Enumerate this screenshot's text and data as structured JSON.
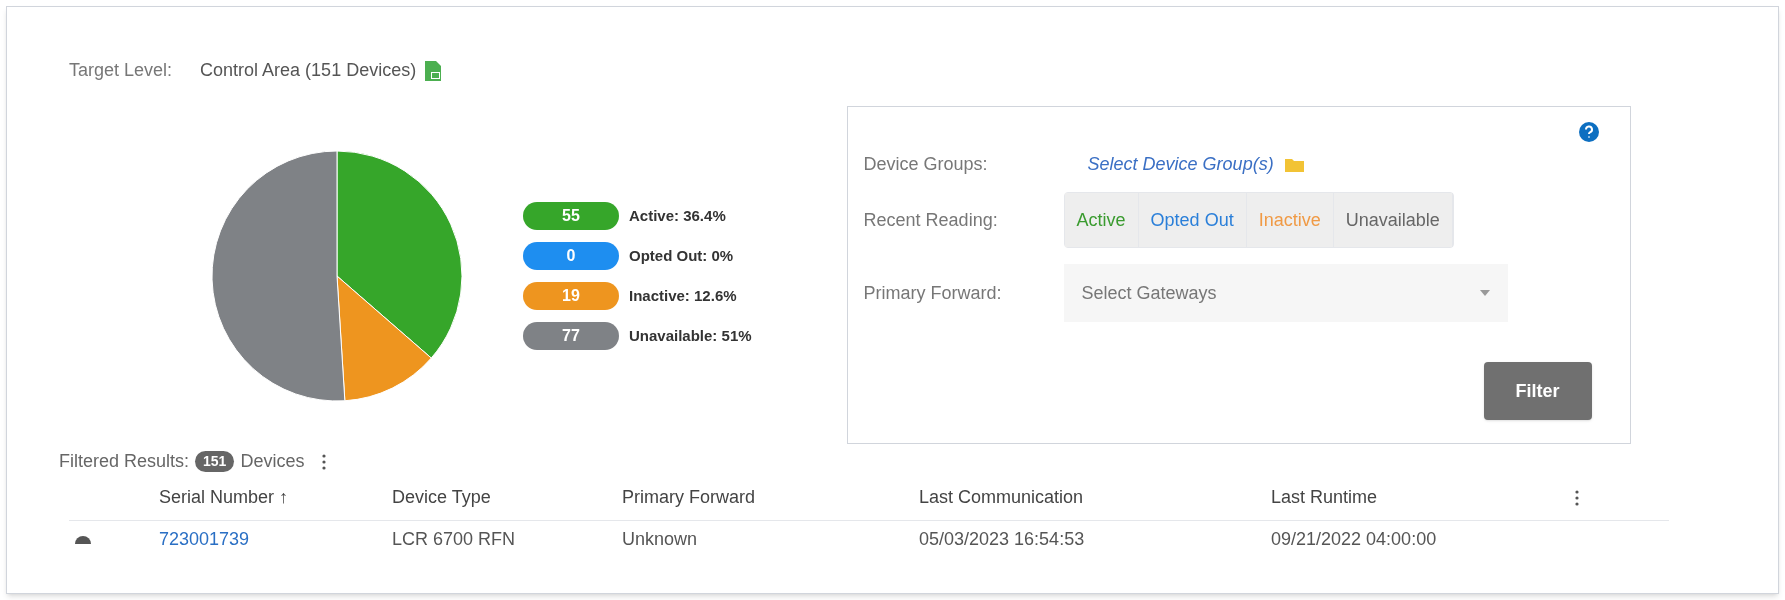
{
  "target": {
    "label": "Target Level:",
    "value": "Control Area (151 Devices)"
  },
  "chart_data": {
    "type": "pie",
    "values": [
      36.4,
      0,
      12.6,
      51
    ]
  },
  "legend": [
    {
      "count": "55",
      "label": "Active: 36.4%",
      "color": "#36a62a"
    },
    {
      "count": "0",
      "label": "Opted Out: 0%",
      "color": "#1e8ef0"
    },
    {
      "count": "19",
      "label": "Inactive: 12.6%",
      "color": "#ee951f"
    },
    {
      "count": "77",
      "label": "Unavailable: 51%",
      "color": "#7f8286"
    }
  ],
  "filter": {
    "device_groups_label": "Device Groups:",
    "device_groups_link": "Select Device Group(s)",
    "recent_reading_label": "Recent Reading:",
    "readings": [
      {
        "label": "Active",
        "color": "#3a9b2f"
      },
      {
        "label": "Opted Out",
        "color": "#2a7fd9"
      },
      {
        "label": "Inactive",
        "color": "#f09a45"
      },
      {
        "label": "Unavailable",
        "color": "#666666"
      }
    ],
    "primary_forward_label": "Primary Forward:",
    "gateways_placeholder": "Select Gateways",
    "button": "Filter"
  },
  "results": {
    "label": "Filtered Results:",
    "count": "151",
    "suffix": "Devices"
  },
  "table": {
    "columns": [
      "Serial Number ↑",
      "Device Type",
      "Primary Forward",
      "Last Communication",
      "Last Runtime"
    ],
    "rows": [
      {
        "serial": "723001739",
        "device_type": "LCR 6700 RFN",
        "primary_forward": "Unknown",
        "last_communication": "05/03/2023 16:54:53",
        "last_runtime": "09/21/2022 04:00:00"
      }
    ]
  }
}
